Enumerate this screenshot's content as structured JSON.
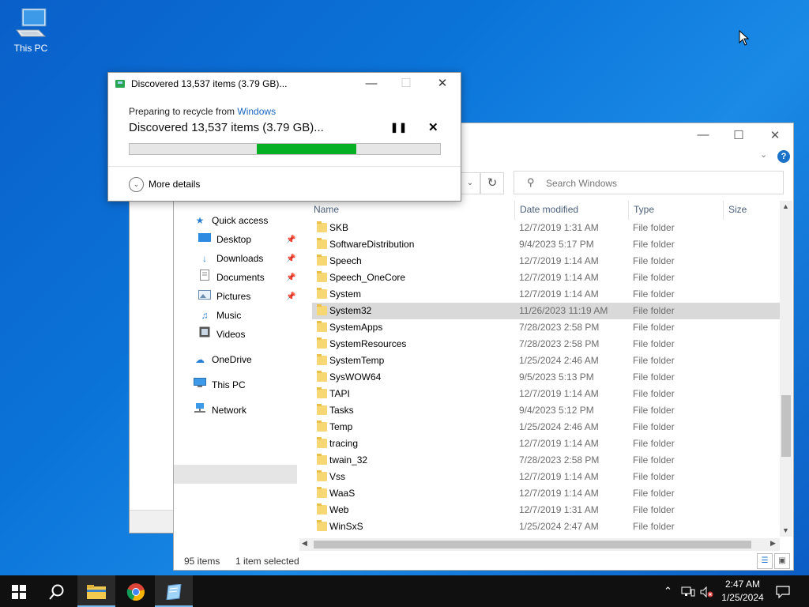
{
  "desktop": {
    "icon_label": "This PC"
  },
  "dialog": {
    "title": "Discovered 13,537 items (3.79 GB)...",
    "prep_prefix": "Preparing to recycle from ",
    "prep_link": "Windows",
    "status_line": "Discovered 13,537 items (3.79 GB)...",
    "progress_start": 0.41,
    "progress_end": 0.73,
    "more_details": "More details",
    "accent": "#06b025"
  },
  "explorer": {
    "search_placeholder": "Search Windows",
    "columns": {
      "name": "Name",
      "date": "Date modified",
      "type": "Type",
      "size": "Size"
    },
    "nav": {
      "quick_access": "Quick access",
      "desktop": "Desktop",
      "downloads": "Downloads",
      "documents": "Documents",
      "pictures": "Pictures",
      "music": "Music",
      "videos": "Videos",
      "onedrive": "OneDrive",
      "this_pc": "This PC",
      "network": "Network"
    },
    "rows": [
      {
        "name": "SKB",
        "date": "12/7/2019 1:31 AM",
        "type": "File folder"
      },
      {
        "name": "SoftwareDistribution",
        "date": "9/4/2023 5:17 PM",
        "type": "File folder"
      },
      {
        "name": "Speech",
        "date": "12/7/2019 1:14 AM",
        "type": "File folder"
      },
      {
        "name": "Speech_OneCore",
        "date": "12/7/2019 1:14 AM",
        "type": "File folder"
      },
      {
        "name": "System",
        "date": "12/7/2019 1:14 AM",
        "type": "File folder"
      },
      {
        "name": "System32",
        "date": "11/26/2023 11:19 AM",
        "type": "File folder"
      },
      {
        "name": "SystemApps",
        "date": "7/28/2023 2:58 PM",
        "type": "File folder"
      },
      {
        "name": "SystemResources",
        "date": "7/28/2023 2:58 PM",
        "type": "File folder"
      },
      {
        "name": "SystemTemp",
        "date": "1/25/2024 2:46 AM",
        "type": "File folder"
      },
      {
        "name": "SysWOW64",
        "date": "9/5/2023 5:13 PM",
        "type": "File folder"
      },
      {
        "name": "TAPI",
        "date": "12/7/2019 1:14 AM",
        "type": "File folder"
      },
      {
        "name": "Tasks",
        "date": "9/4/2023 5:12 PM",
        "type": "File folder"
      },
      {
        "name": "Temp",
        "date": "1/25/2024 2:46 AM",
        "type": "File folder"
      },
      {
        "name": "tracing",
        "date": "12/7/2019 1:14 AM",
        "type": "File folder"
      },
      {
        "name": "twain_32",
        "date": "7/28/2023 2:58 PM",
        "type": "File folder"
      },
      {
        "name": "Vss",
        "date": "12/7/2019 1:14 AM",
        "type": "File folder"
      },
      {
        "name": "WaaS",
        "date": "12/7/2019 1:14 AM",
        "type": "File folder"
      },
      {
        "name": "Web",
        "date": "12/7/2019 1:31 AM",
        "type": "File folder"
      },
      {
        "name": "WinSxS",
        "date": "1/25/2024 2:47 AM",
        "type": "File folder"
      }
    ],
    "selected_name": "System32",
    "status_count": "95 items",
    "status_selected": "1 item selected"
  },
  "taskbar": {
    "time": "2:47 AM",
    "date": "1/25/2024"
  }
}
